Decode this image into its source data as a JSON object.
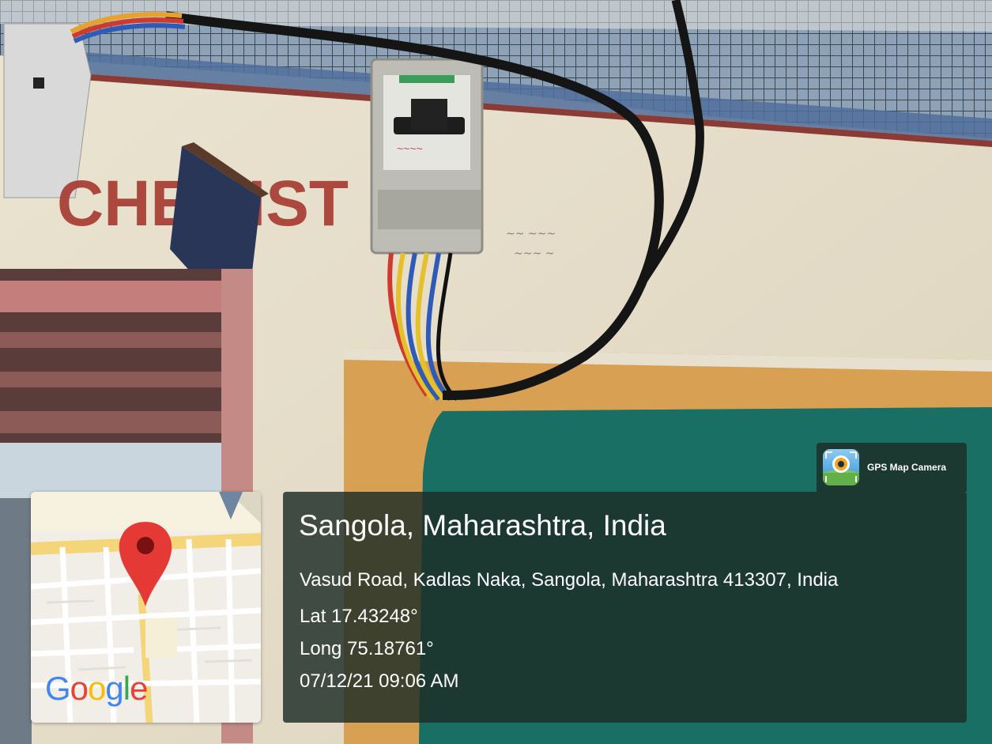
{
  "photo": {
    "description_icon": "photo-scene",
    "wall_sign_text": "CHEMIST"
  },
  "map": {
    "logo_text": [
      "G",
      "o",
      "o",
      "g",
      "l",
      "e"
    ],
    "logo_colors": [
      "#4285F4",
      "#EA4335",
      "#FBBC05",
      "#4285F4",
      "#34A853",
      "#EA4335"
    ],
    "marker_color": "#E53935",
    "pin_icon": "map-pin-icon"
  },
  "brand": {
    "label": "GPS Map Camera",
    "icon": "gps-map-camera-icon"
  },
  "location": {
    "title": "Sangola, Maharashtra, India",
    "address": "Vasud Road, Kadlas Naka, Sangola, Maharashtra 413307, India",
    "lat": "Lat 17.43248°",
    "long": "Long 75.18761°",
    "datetime": "07/12/21 09:06 AM"
  }
}
